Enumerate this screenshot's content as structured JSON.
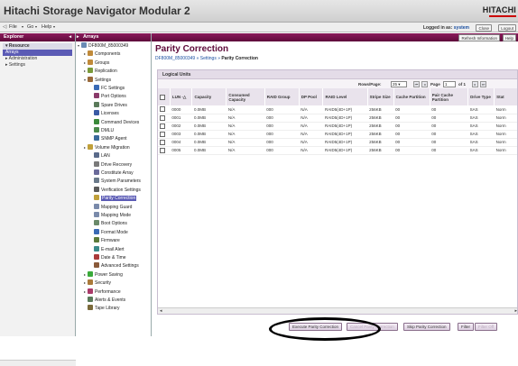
{
  "app": {
    "title": "Hitachi Storage Navigator Modular 2",
    "brand": "HITACHI"
  },
  "menubar": {
    "items": [
      "File",
      "Go",
      "Help"
    ],
    "login_label": "Logged in as:",
    "login_user": "system",
    "close_label": "Close",
    "logout_label": "Logout"
  },
  "explorer": {
    "header": "Explorer",
    "items": [
      "Resource",
      "Arrays",
      "Administration",
      "Settings"
    ]
  },
  "tree": {
    "header": "Arrays",
    "nodes": [
      "DF800M_85000349",
      "Components",
      "Groups",
      "Replication",
      "Settings",
      "FC Settings",
      "Port Options",
      "Spare Drives",
      "Licenses",
      "Command Devices",
      "DMLU",
      "SNMP Agent",
      "Volume Migration",
      "LAN",
      "Drive Recovery",
      "Constitute Array",
      "System Parameters",
      "Verification Settings",
      "Parity Correction",
      "Mapping Guard",
      "Mapping Mode",
      "Boot Options",
      "Format Mode",
      "Firmware",
      "E-mail Alert",
      "Date & Time",
      "Advanced Settings",
      "Power Saving",
      "Security",
      "Performance",
      "Alerts & Events",
      "Tape Library"
    ]
  },
  "main": {
    "refresh_label": "Refresh Information",
    "help_label": "Help",
    "title": "Parity Correction",
    "breadcrumb": {
      "root": "DF800M_85000349",
      "mid": "Settings",
      "current": "Parity Correction"
    },
    "panel_title": "Logical Units",
    "pager": {
      "rows_label": "Rows/Page:",
      "rows_value": "25",
      "page_label": "Page",
      "page_value": "1",
      "of_label": "of 1"
    }
  },
  "table": {
    "columns": [
      "LUN",
      "Capacity",
      "Consumed Capacity",
      "RAID Group",
      "DP Pool",
      "RAID Level",
      "Stripe Size",
      "Cache Partition",
      "Pair Cache Partition",
      "Drive Type",
      "Stat"
    ],
    "rows": [
      [
        "0000",
        "0.0MB",
        "N/A",
        "000",
        "N/A",
        "RAID5(4D+1P)",
        "256KB",
        "00",
        "00",
        "SAS",
        "Norm"
      ],
      [
        "0001",
        "0.0MB",
        "N/A",
        "000",
        "N/A",
        "RAID5(4D+1P)",
        "256KB",
        "00",
        "00",
        "SAS",
        "Norm"
      ],
      [
        "0002",
        "0.0MB",
        "N/A",
        "000",
        "N/A",
        "RAID5(4D+1P)",
        "256KB",
        "00",
        "00",
        "SAS",
        "Norm"
      ],
      [
        "0003",
        "0.0MB",
        "N/A",
        "000",
        "N/A",
        "RAID5(4D+1P)",
        "256KB",
        "00",
        "00",
        "SAS",
        "Norm"
      ],
      [
        "0004",
        "0.0MB",
        "N/A",
        "000",
        "N/A",
        "RAID5(4D+1P)",
        "256KB",
        "00",
        "00",
        "SAS",
        "Norm"
      ],
      [
        "0005",
        "0.0MB",
        "N/A",
        "000",
        "N/A",
        "RAID5(4D+1P)",
        "256KB",
        "00",
        "00",
        "SAS",
        "Norm"
      ]
    ]
  },
  "actions": {
    "execute": "Execute Parity Correction",
    "cancel": "Cancel Parity Correction",
    "skip": "Skip Parity Correction",
    "filter": "Filter",
    "filter_off": "Filter Off"
  },
  "colors": {
    "accent": "#5e0a3a",
    "selection": "#5b5bb5",
    "brand_red": "#cc0000"
  }
}
